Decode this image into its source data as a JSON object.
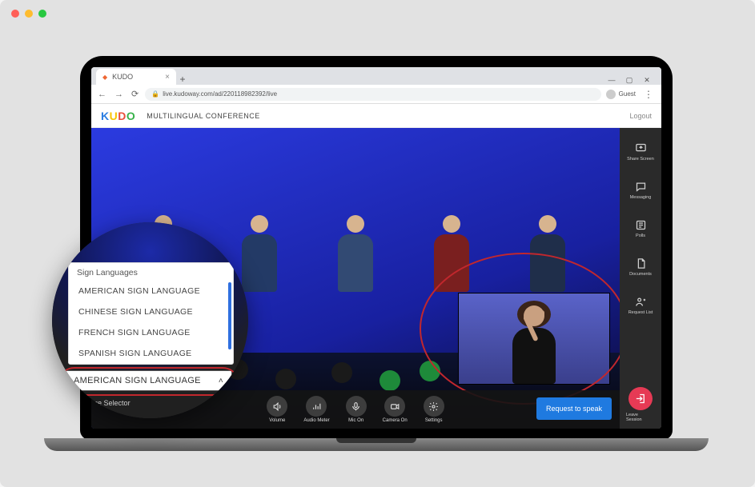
{
  "browser": {
    "tab_title": "KUDO",
    "url": "live.kudoway.com/ad/220118982392/live",
    "guest_label": "Guest"
  },
  "app": {
    "logo_text": "KUDO",
    "title": "MULTILINGUAL CONFERENCE",
    "logout": "Logout"
  },
  "toolbar": {
    "volume": "Volume",
    "audio_meter": "Audio Meter",
    "mic": "Mic On",
    "camera": "Camera On",
    "settings": "Settings",
    "request_to_speak": "Request to speak"
  },
  "rail": {
    "share_screen": "Share Screen",
    "messaging": "Messaging",
    "polls": "Polls",
    "documents": "Documents",
    "request_list": "Request List",
    "leave": "Leave Session"
  },
  "language_selector": {
    "heading": "Sign Languages",
    "options": [
      "AMERICAN SIGN LANGUAGE",
      "CHINESE SIGN LANGUAGE",
      "FRENCH SIGN LANGUAGE",
      "SPANISH SIGN LANGUAGE"
    ],
    "selected": "AMERICAN SIGN LANGUAGE",
    "label": "Language Selector"
  }
}
